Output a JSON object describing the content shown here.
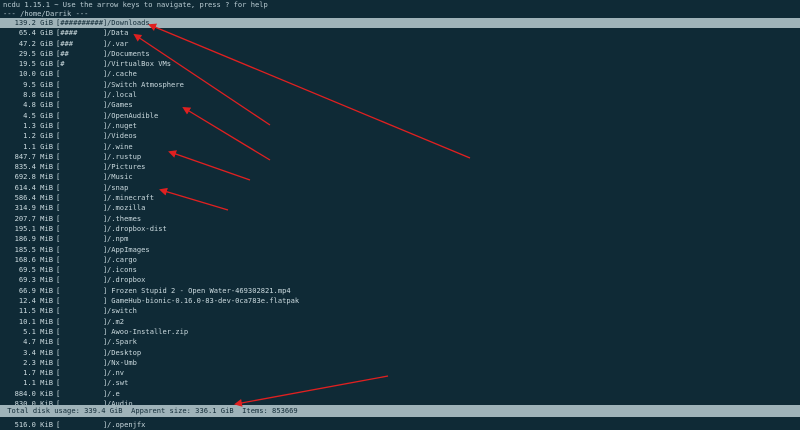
{
  "app": {
    "header": "ncdu 1.15.1 ~ Use the arrow keys to navigate, press ? for help",
    "path": "--- /home/Darrik ---"
  },
  "entries": [
    {
      "size": "139.2 GiB",
      "bar": "[##########]",
      "name": "/Downloads",
      "selected": true
    },
    {
      "size": "65.4 GiB",
      "bar": "[####      ]",
      "name": "/Data"
    },
    {
      "size": "47.2 GiB",
      "bar": "[###       ]",
      "name": "/.var"
    },
    {
      "size": "29.5 GiB",
      "bar": "[##        ]",
      "name": "/Documents"
    },
    {
      "size": "19.5 GiB",
      "bar": "[#         ]",
      "name": "/VirtualBox VMs"
    },
    {
      "size": "10.0 GiB",
      "bar": "[          ]",
      "name": "/.cache"
    },
    {
      "size": "9.5 GiB",
      "bar": "[          ]",
      "name": "/Switch Atmosphere"
    },
    {
      "size": "8.8 GiB",
      "bar": "[          ]",
      "name": "/.local"
    },
    {
      "size": "4.8 GiB",
      "bar": "[          ]",
      "name": "/Games"
    },
    {
      "size": "4.5 GiB",
      "bar": "[          ]",
      "name": "/OpenAudible"
    },
    {
      "size": "1.3 GiB",
      "bar": "[          ]",
      "name": "/.nuget"
    },
    {
      "size": "1.2 GiB",
      "bar": "[          ]",
      "name": "/Videos"
    },
    {
      "size": "1.1 GiB",
      "bar": "[          ]",
      "name": "/.wine"
    },
    {
      "size": "847.7 MiB",
      "bar": "[          ]",
      "name": "/.rustup"
    },
    {
      "size": "835.4 MiB",
      "bar": "[          ]",
      "name": "/Pictures"
    },
    {
      "size": "692.8 MiB",
      "bar": "[          ]",
      "name": "/Music"
    },
    {
      "size": "614.4 MiB",
      "bar": "[          ]",
      "name": "/snap"
    },
    {
      "size": "586.4 MiB",
      "bar": "[          ]",
      "name": "/.minecraft"
    },
    {
      "size": "314.9 MiB",
      "bar": "[          ]",
      "name": "/.mozilla"
    },
    {
      "size": "207.7 MiB",
      "bar": "[          ]",
      "name": "/.themes"
    },
    {
      "size": "195.1 MiB",
      "bar": "[          ]",
      "name": "/.dropbox-dist"
    },
    {
      "size": "186.9 MiB",
      "bar": "[          ]",
      "name": "/.npm"
    },
    {
      "size": "185.5 MiB",
      "bar": "[          ]",
      "name": "/AppImages"
    },
    {
      "size": "168.6 MiB",
      "bar": "[          ]",
      "name": "/.cargo"
    },
    {
      "size": "69.5 MiB",
      "bar": "[          ]",
      "name": "/.icons"
    },
    {
      "size": "69.3 MiB",
      "bar": "[          ]",
      "name": "/.dropbox"
    },
    {
      "size": "66.9 MiB",
      "bar": "[          ]",
      "name": " Frozen Stupid 2 - Open Water-469302821.mp4"
    },
    {
      "size": "12.4 MiB",
      "bar": "[          ]",
      "name": " GameHub-bionic-0.16.0-83-dev-0ca783e.flatpak"
    },
    {
      "size": "11.5 MiB",
      "bar": "[          ]",
      "name": "/switch"
    },
    {
      "size": "10.1 MiB",
      "bar": "[          ]",
      "name": "/.m2"
    },
    {
      "size": "5.1 MiB",
      "bar": "[          ]",
      "name": " Awoo-Installer.zip"
    },
    {
      "size": "4.7 MiB",
      "bar": "[          ]",
      "name": "/.Spark"
    },
    {
      "size": "3.4 MiB",
      "bar": "[          ]",
      "name": "/Desktop"
    },
    {
      "size": "2.3 MiB",
      "bar": "[          ]",
      "name": "/Nx-Umb"
    },
    {
      "size": "1.7 MiB",
      "bar": "[          ]",
      "name": "/.nv"
    },
    {
      "size": "1.1 MiB",
      "bar": "[          ]",
      "name": "/.swt"
    },
    {
      "size": "884.0 KiB",
      "bar": "[          ]",
      "name": "/.e"
    },
    {
      "size": "830.0 KiB",
      "bar": "[          ]",
      "name": "/Audio"
    },
    {
      "size": "652.0 KiB",
      "bar": "[          ]",
      "name": "/.mednafen"
    },
    {
      "size": "516.0 KiB",
      "bar": "[          ]",
      "name": "/.openjfx"
    }
  ],
  "status": {
    "text": " Total disk usage: 339.4 GiB  Apparent size: 336.1 GiB  Items: 853669"
  },
  "colors": {
    "background": "#0f2a36",
    "highlight": "#9fb3b9",
    "annotation_arrow": "#e02020"
  }
}
